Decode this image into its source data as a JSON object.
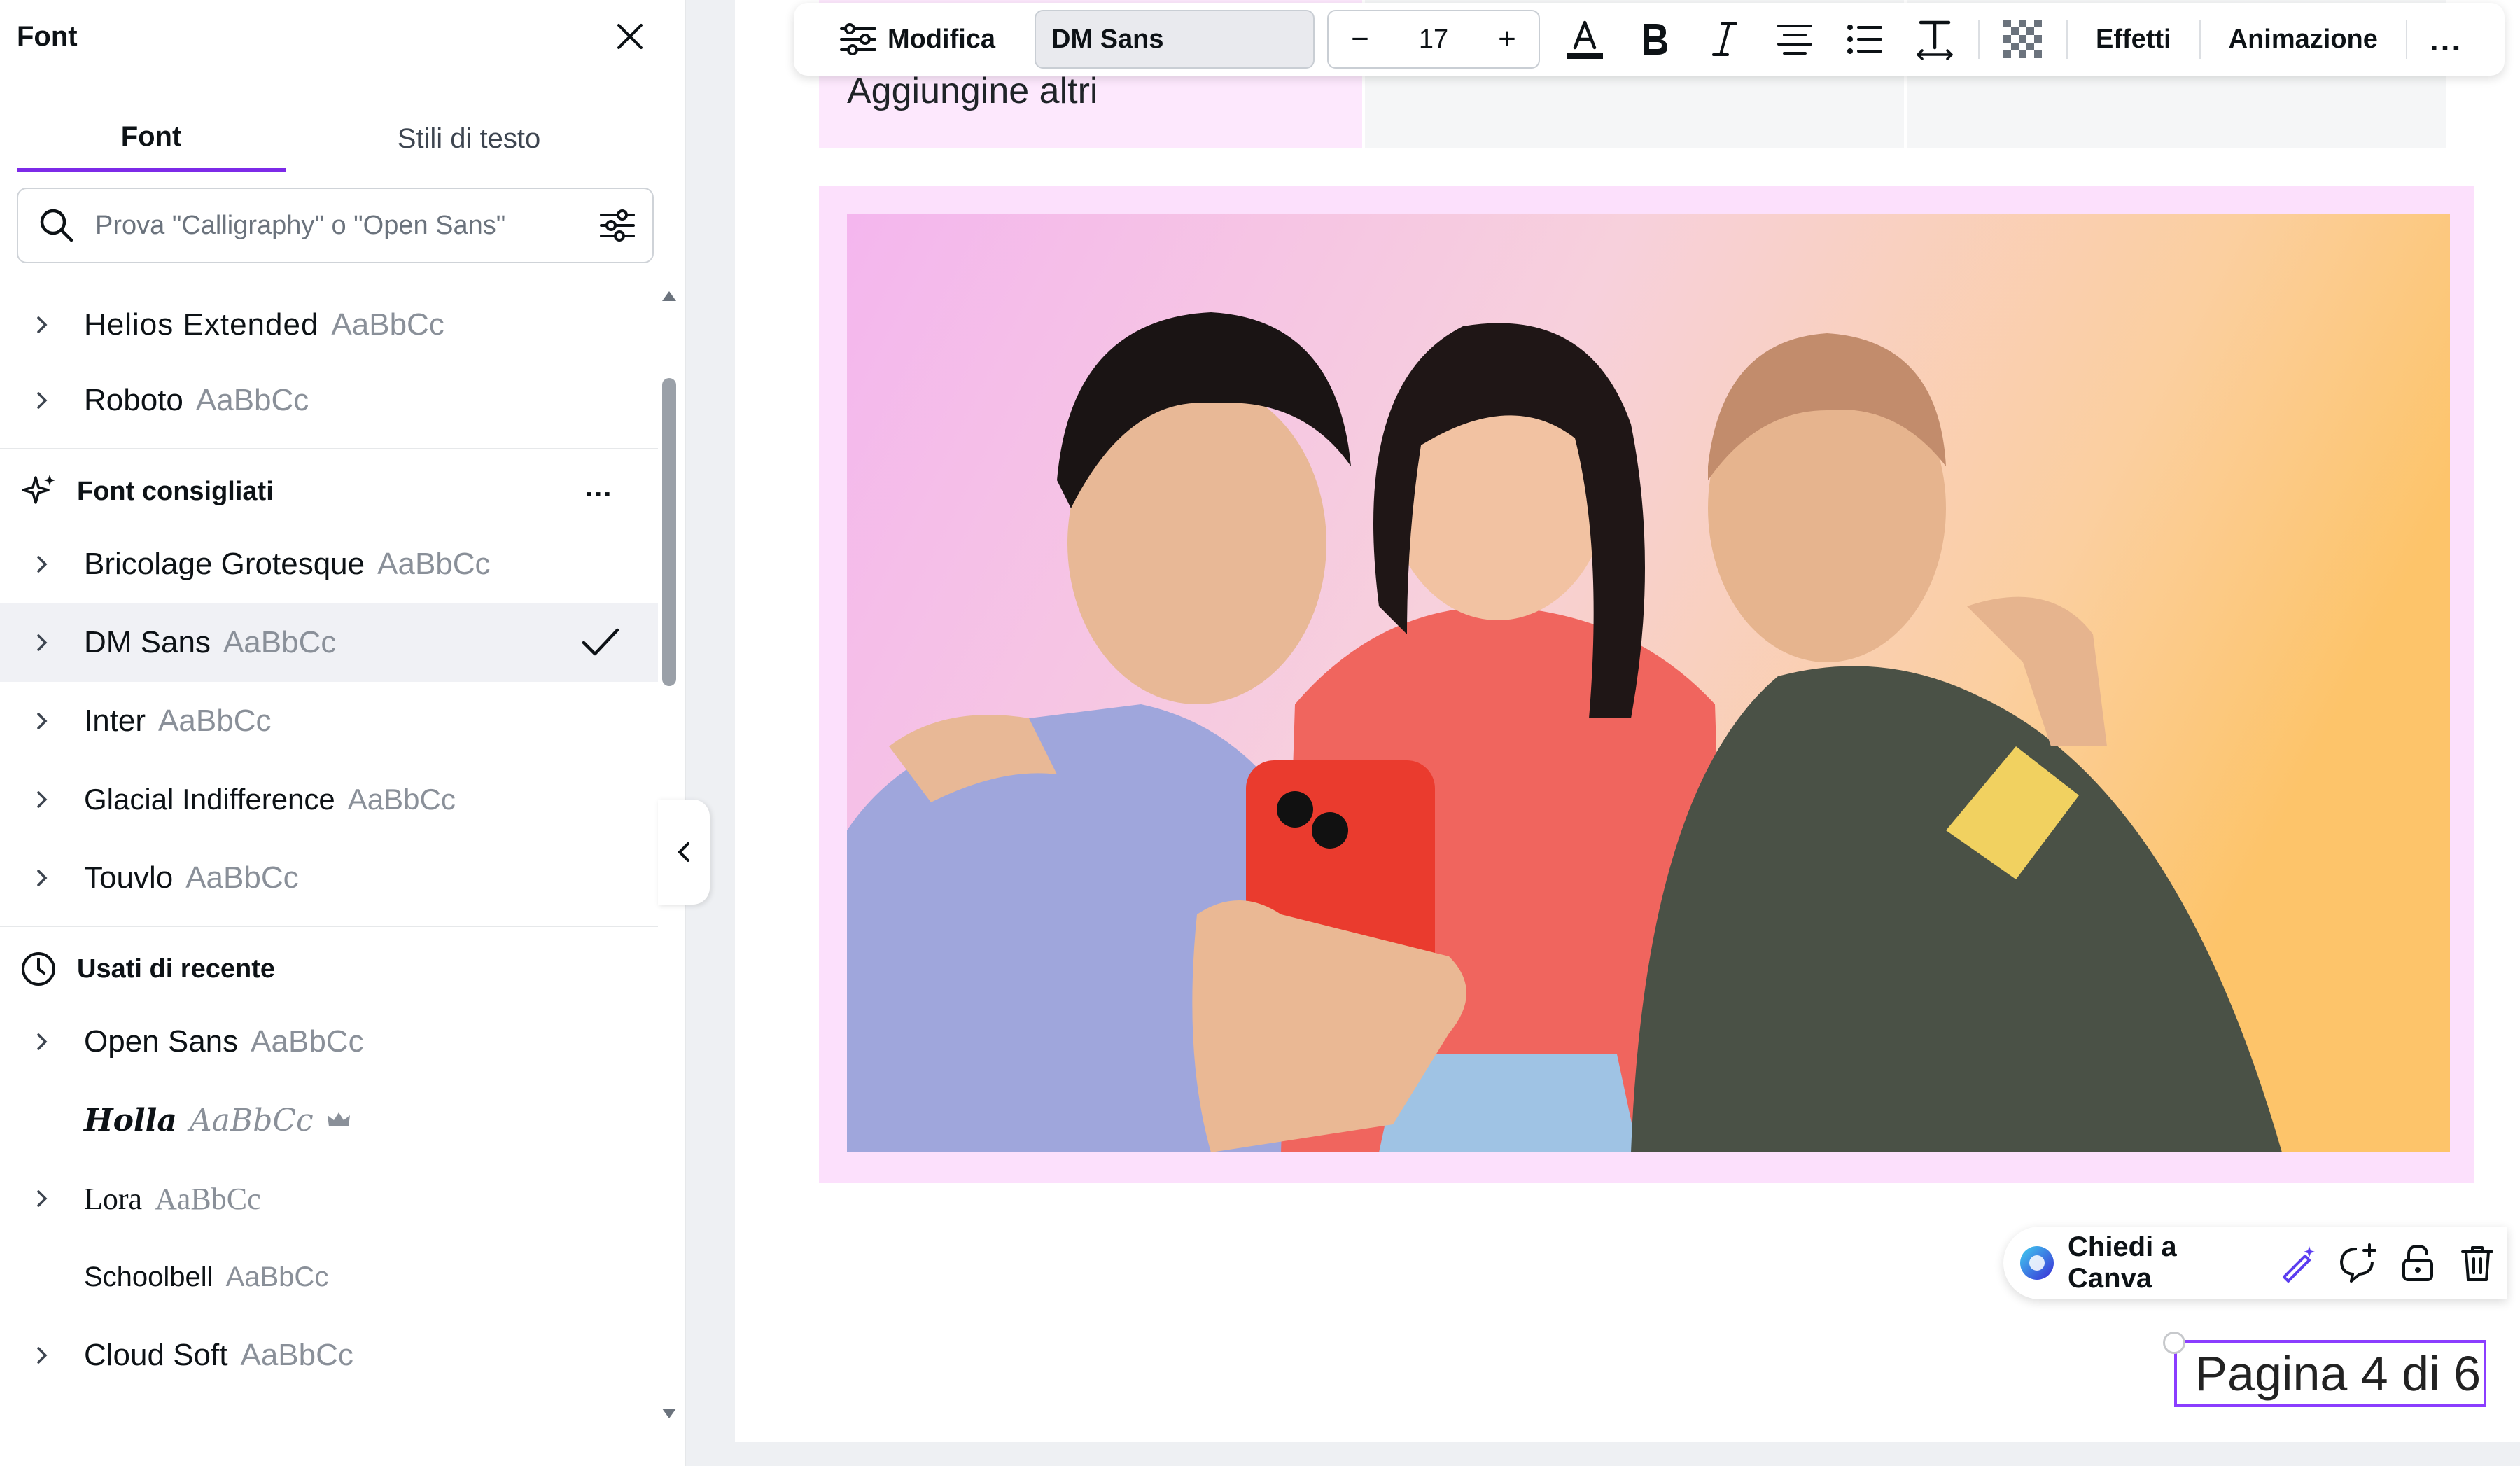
{
  "panel": {
    "title": "Font",
    "tabs": [
      {
        "label": "Font",
        "active": true
      },
      {
        "label": "Stili di testo",
        "active": false
      }
    ],
    "search": {
      "placeholder": "Prova \"Calligraphy\" o \"Open Sans\"",
      "value": ""
    },
    "top_fonts": [
      {
        "name": "Helios Extended",
        "sample": "AaBbCc"
      },
      {
        "name": "Roboto",
        "sample": "AaBbCc"
      }
    ],
    "recommended": {
      "title": "Font consigliati",
      "more": "...",
      "items": [
        {
          "name": "Bricolage Grotesque",
          "sample": "AaBbCc"
        },
        {
          "name": "DM Sans",
          "sample": "AaBbCc",
          "selected": true
        },
        {
          "name": "Inter",
          "sample": "AaBbCc"
        },
        {
          "name": "Glacial Indifference",
          "sample": "AaBbCc"
        },
        {
          "name": "Touvlo",
          "sample": "AaBbCc"
        }
      ]
    },
    "recent": {
      "title": "Usati di recente",
      "items": [
        {
          "name": "Open Sans",
          "sample": "AaBbCc",
          "expandable": true
        },
        {
          "name": "Holla",
          "sample": "AaBbCc",
          "expandable": false,
          "premium": true
        },
        {
          "name": "Lora",
          "sample": "AaBbCc",
          "expandable": true
        },
        {
          "name": "Schoolbell",
          "sample": "AaBbCc",
          "expandable": false
        },
        {
          "name": "Cloud Soft",
          "sample": "AaBbCc",
          "expandable": true
        }
      ]
    }
  },
  "toolbar": {
    "edit_label": "Modifica",
    "font_name": "DM Sans",
    "font_size": "17",
    "minus": "−",
    "plus": "+",
    "effects_label": "Effetti",
    "animation_label": "Animazione",
    "more": "..."
  },
  "canvas": {
    "table_cell_text": "Aggiungine altri",
    "page_label": "Pagina 4 di 6"
  },
  "context_bar": {
    "ask_label": "Chiedi a Canva"
  },
  "colors": {
    "accent": "#7d2ae8",
    "selection": "#8b3dff",
    "frame_pink": "#fce0fc",
    "cell_pink": "#fde8fd",
    "text_color_underline": "#0d1216"
  }
}
